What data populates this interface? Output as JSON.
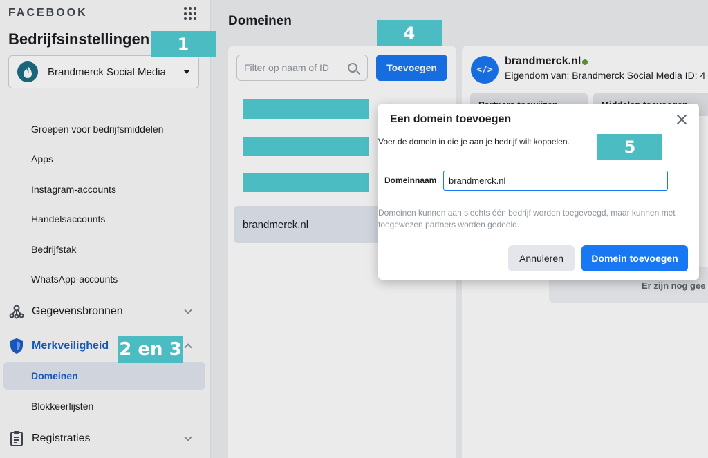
{
  "sidebar": {
    "logo": "FACEBOOK",
    "heading": "Bedrijfsinstellingen",
    "business_name": "Brandmerck Social Media",
    "items": [
      {
        "label": "Groepen voor bedrijfsmiddelen"
      },
      {
        "label": "Apps"
      },
      {
        "label": "Instagram-accounts"
      },
      {
        "label": "Handelsaccounts"
      },
      {
        "label": "Bedrijfstak"
      },
      {
        "label": "WhatsApp-accounts"
      }
    ],
    "groups": {
      "data_sources": "Gegevensbronnen",
      "brand_safety": "Merkveiligheid",
      "registrations": "Registraties"
    },
    "sub_items": {
      "domains": "Domeinen",
      "block_lists": "Blokkeerlijsten"
    }
  },
  "main": {
    "title": "Domeinen",
    "search_placeholder": "Filter op naam of ID",
    "add_button": "Toevoegen",
    "domain_item": "brandmerck.nl"
  },
  "detail": {
    "icon_text": "</>",
    "title": "brandmerck.nl",
    "owner": "Eigendom van: Brandmerck Social Media  ID: 4",
    "btn_partners": "Partners toewijzen",
    "btn_assets": "Middelen toevoegen",
    "empty_text": "Er zijn nog gee"
  },
  "dialog": {
    "title": "Een domein toevoegen",
    "description": "Voer de domein in die je aan je bedrijf wilt koppelen.",
    "field_label": "Domeinnaam",
    "field_value": "brandmerck.nl",
    "note": "Domeinen kunnen aan slechts één bedrijf worden toegevoegd, maar kunnen met toegewezen partners worden gedeeld.",
    "cancel": "Annuleren",
    "submit": "Domein toevoegen"
  },
  "annotations": {
    "step1": "1",
    "step23": "2 en 3",
    "step4": "4",
    "step5": "5"
  },
  "colors": {
    "accent": "#1877f2",
    "highlight": "#4bbcc1",
    "active_bg": "#e2e7ef",
    "status_green": "#5f9c3a"
  }
}
